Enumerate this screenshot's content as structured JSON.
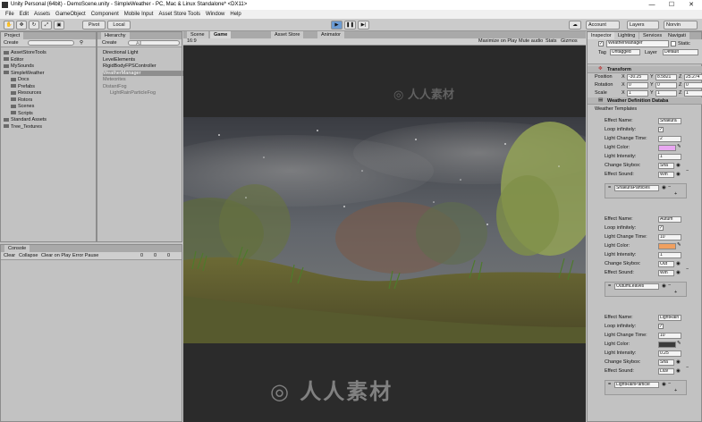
{
  "window": {
    "title": "Unity Personal (64bit) - DemoScene.unity - SimpleWeather - PC, Mac & Linux Standalone* <DX11>",
    "controls": [
      "—",
      "☐",
      "✕"
    ]
  },
  "menu": [
    "File",
    "Edit",
    "Assets",
    "GameObject",
    "Component",
    "Mobile Input",
    "Asset Store Tools",
    "Window",
    "Help"
  ],
  "toolbar": {
    "pivot": "Pivot",
    "local": "Local",
    "account": "Account",
    "layers": "Layers",
    "layout": "Norvin"
  },
  "project": {
    "tab": "Project",
    "create": "Create",
    "items": [
      "AssetStoreTools",
      "Editor",
      "MySounds",
      "SimpleWeather",
      "Docs",
      "Prefabs",
      "Resources",
      "Rotors",
      "Scenes",
      "Scripts",
      "Standard Assets",
      "Tree_Textures"
    ]
  },
  "hierarchy": {
    "tab": "Hierarchy",
    "create": "Create",
    "search": "All",
    "items": [
      "Directional Light",
      "LevelElements",
      "RigidBodyFPSController",
      "WeatherManager",
      "Meteorites",
      "DistantFog",
      "LightRainParticleFog"
    ]
  },
  "console": {
    "tab": "Console",
    "buttons": [
      "Clear",
      "Collapse",
      "Clear on Play",
      "Error Pause"
    ],
    "counts": [
      "0",
      "0",
      "0"
    ]
  },
  "viewtabs": {
    "tabs": [
      "Scene",
      "Game",
      "Asset Store",
      "Animator"
    ],
    "aspect": "16:9",
    "options": [
      "Maximize on Play",
      "Mute audio",
      "Stats",
      "Gizmos"
    ]
  },
  "inspector": {
    "tabs": [
      "Inspector",
      "Lighting",
      "Services",
      "Navigati"
    ],
    "object_name": "WeatherManager",
    "static": "Static",
    "tag_label": "Tag",
    "tag_value": "Untagged",
    "layer_label": "Layer",
    "layer_value": "Default",
    "transform": {
      "header": "Transform",
      "rows": [
        {
          "label": "Position",
          "x": "-30.25",
          "y": "8.5821",
          "z": "25.274"
        },
        {
          "label": "Rotation",
          "x": "0",
          "y": "0",
          "z": "0"
        },
        {
          "label": "Scale",
          "x": "1",
          "y": "1",
          "z": "1"
        }
      ]
    },
    "weather": {
      "header": "Weather Definition Databa",
      "templates_label": "Weather Templates",
      "labels": [
        "Effect Name:",
        "Loop infinitely:",
        "Light Change Time:",
        "Light Color:",
        "Light Intensity:",
        "Change Skybox:",
        "Effect Sound:"
      ],
      "entries": [
        {
          "name": "Shakura",
          "time": "2",
          "color": "#e9a8f2",
          "intensity": "1",
          "skybox": "Sha",
          "sound": "Win",
          "particles": "ShakuraParticles"
        },
        {
          "name": "Autum",
          "time": "10",
          "color": "#f0a060",
          "intensity": "1",
          "skybox": "Out",
          "sound": "Win",
          "particles": "OutumLeaves"
        },
        {
          "name": "LightRain",
          "time": "10",
          "color": "#3a3a3a",
          "intensity": "0.25",
          "skybox": "Sha",
          "sound": "Lluv",
          "particles": "LightRainParticle"
        }
      ]
    }
  },
  "watermark": "人人素材"
}
